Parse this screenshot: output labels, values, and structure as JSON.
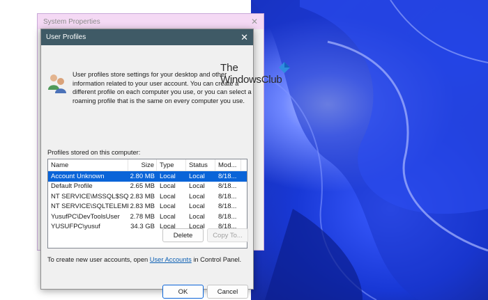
{
  "system_window": {
    "title": "System Properties"
  },
  "dialog": {
    "title": "User Profiles",
    "description": "User profiles store settings for your desktop and other information related to your user account. You can create a different profile on each computer you use, or you can select a roaming profile that is the same on every computer you use.",
    "profiles_label": "Profiles stored on this computer:",
    "columns": [
      "Name",
      "Size",
      "Type",
      "Status",
      "Mod..."
    ],
    "rows": [
      {
        "name": "Account Unknown",
        "size": "2.80 MB",
        "type": "Local",
        "status": "Local",
        "modified": "8/18...",
        "selected": true
      },
      {
        "name": "Default Profile",
        "size": "2.65 MB",
        "type": "Local",
        "status": "Local",
        "modified": "8/18...",
        "selected": false
      },
      {
        "name": "NT SERVICE\\MSSQL$SQLE...",
        "size": "2.83 MB",
        "type": "Local",
        "status": "Local",
        "modified": "8/18...",
        "selected": false
      },
      {
        "name": "NT SERVICE\\SQLTELEMET...",
        "size": "2.83 MB",
        "type": "Local",
        "status": "Local",
        "modified": "8/18...",
        "selected": false
      },
      {
        "name": "YusufPC\\DevToolsUser",
        "size": "2.78 MB",
        "type": "Local",
        "status": "Local",
        "modified": "8/18...",
        "selected": false
      },
      {
        "name": "YUSUFPC\\yusuf",
        "size": "34.3 GB",
        "type": "Local",
        "status": "Local",
        "modified": "8/18...",
        "selected": false
      }
    ],
    "delete_label": "Delete",
    "copy_to_label": "Copy To...",
    "footer_prefix": "To create new user accounts, open ",
    "footer_link": "User Accounts",
    "footer_suffix": " in Control Panel.",
    "ok_label": "OK",
    "cancel_label": "Cancel"
  },
  "watermark": {
    "line1": "The",
    "line2": "WindowsClub"
  },
  "colors": {
    "selection": "#0a64d8",
    "titlebar": "#3f5a66",
    "link": "#0b5fb3"
  }
}
